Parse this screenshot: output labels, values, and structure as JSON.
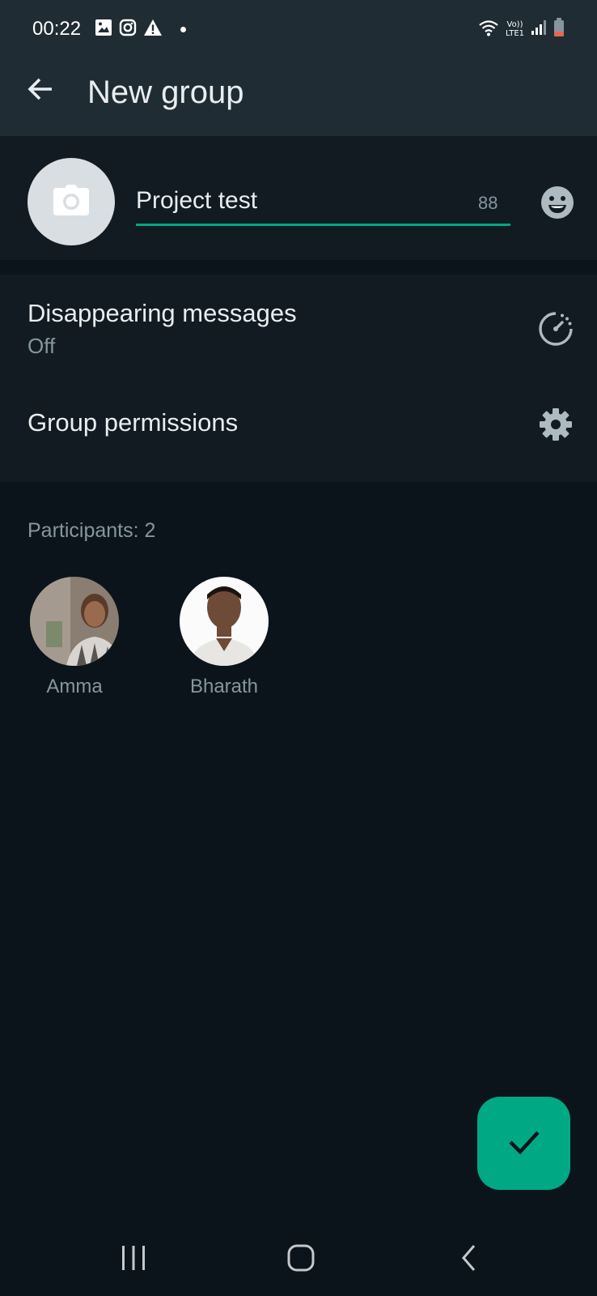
{
  "status_bar": {
    "time": "00:22",
    "left_icons": [
      "gallery-icon",
      "instagram-icon",
      "warning-icon"
    ],
    "right_icons": [
      "wifi-icon",
      "volte-icon",
      "signal-icon",
      "battery-icon"
    ],
    "volte_line1": "Vo))",
    "volte_line2": "LTE1"
  },
  "header": {
    "back_icon": "arrow-left-icon",
    "title": "New group"
  },
  "group_name": {
    "photo_icon": "camera-icon",
    "value": "Project test",
    "remaining_chars": "88",
    "emoji_icon": "emoji-icon"
  },
  "settings": {
    "disappearing": {
      "title": "Disappearing messages",
      "subtitle": "Off",
      "icon": "disappearing-timer-icon"
    },
    "permissions": {
      "title": "Group permissions",
      "icon": "gear-icon"
    }
  },
  "participants": {
    "label": "Participants: 2",
    "items": [
      {
        "name": "Amma"
      },
      {
        "name": "Bharath"
      }
    ]
  },
  "fab": {
    "icon": "checkmark-icon"
  },
  "nav_bar": {
    "icons": [
      "recent-apps-icon",
      "home-icon",
      "back-icon"
    ]
  },
  "colors": {
    "header_bg": "#1f2c34",
    "section_bg": "#111b21",
    "page_bg": "#0b141a",
    "accent": "#00a884",
    "primary_text": "#e9edef",
    "secondary_text": "#8696a0"
  }
}
